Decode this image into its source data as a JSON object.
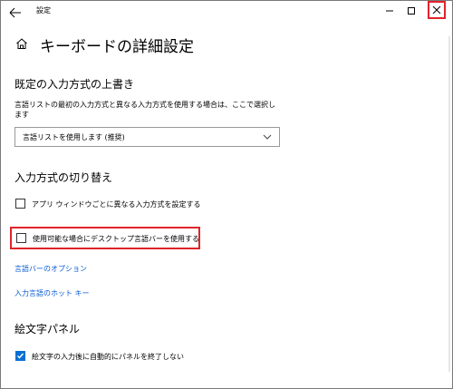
{
  "window": {
    "title": "設定",
    "minimize_glyph": "—",
    "maximize_glyph": "☐",
    "close_glyph": "✕",
    "accent_color": "#e0242a"
  },
  "page": {
    "home_icon": "home-icon",
    "title": "キーボードの詳細設定"
  },
  "override": {
    "heading": "既定の入力方式の上書き",
    "description_line1": "言語リストの最初の入力方式と異なる入力方式を使用する場合は、ここで選択し",
    "description_line2": "ます",
    "dropdown_value": "言語リストを使用します (推奨)"
  },
  "switching": {
    "heading": "入力方式の切り替え",
    "per_app_label": "アプリ ウィンドウごとに異なる入力方式を設定する",
    "per_app_checked": false,
    "desktop_bar_label": "使用可能な場合にデスクトップ言語バーを使用する",
    "desktop_bar_checked": false,
    "language_bar_options_link": "言語バーのオプション",
    "hotkeys_link": "入力言語のホット キー"
  },
  "emoji": {
    "heading": "絵文字パネル",
    "auto_close_label": "絵文字の入力後に自動的にパネルを終了しない",
    "auto_close_checked": true
  }
}
